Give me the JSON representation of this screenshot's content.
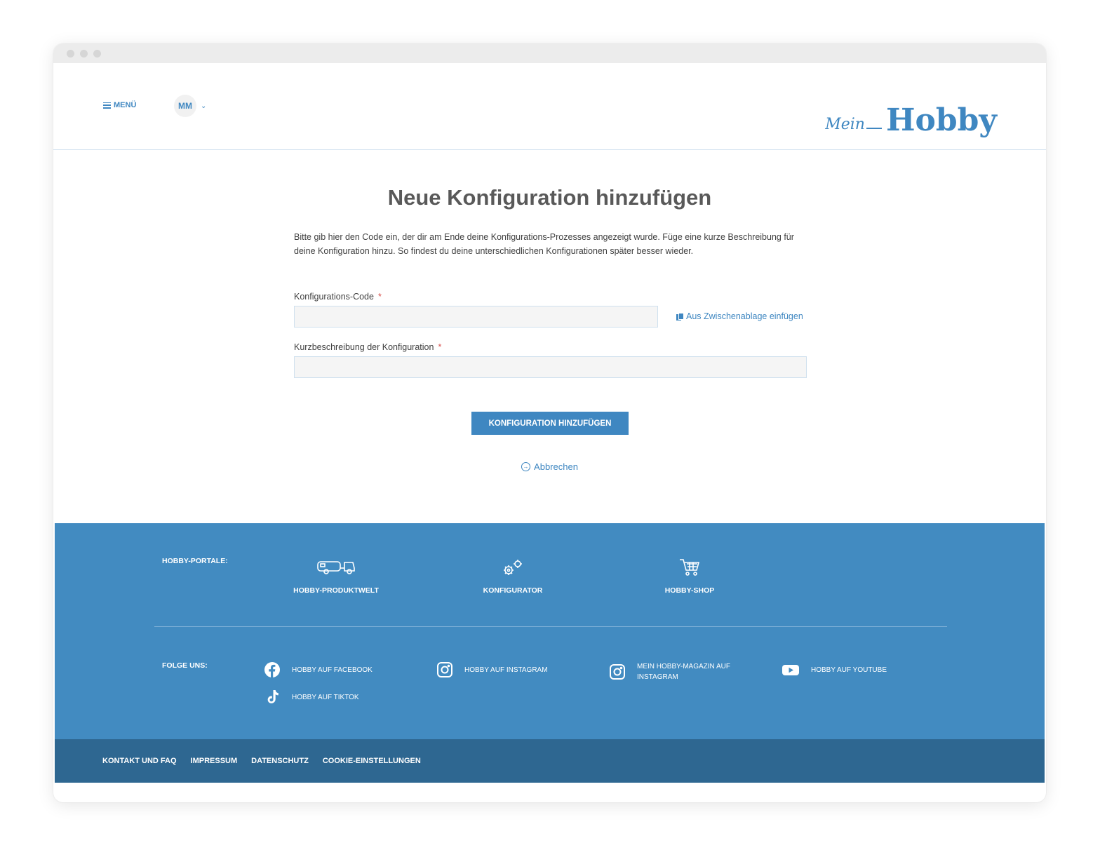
{
  "header": {
    "menu_label": "MENÜ",
    "user_initials": "MM",
    "logo_script": "Mein",
    "logo_text": "Hobby"
  },
  "main": {
    "title": "Neue Konfiguration hinzufügen",
    "intro": "Bitte gib hier den Code ein, der dir am Ende deine Konfigurations-Prozesses angezeigt wurde. Füge eine kurze Beschreibung für deine Konfiguration hinzu. So findest du deine unterschiedlichen Konfigurationen später besser wieder.",
    "code_label": "Konfigurations-Code",
    "code_value": "",
    "paste_label": "Aus Zwischenablage einfügen",
    "desc_label": "Kurzbeschreibung der Konfiguration",
    "desc_value": "",
    "required_mark": "*",
    "submit_label": "KONFIGURATION HINZUFÜGEN",
    "cancel_label": "Abbrechen"
  },
  "footer": {
    "portals_label": "HOBBY-PORTALE:",
    "portals": [
      {
        "label": "HOBBY-PRODUKTWELT",
        "icon": "caravan-icon"
      },
      {
        "label": "KONFIGURATOR",
        "icon": "gears-icon"
      },
      {
        "label": "HOBBY-SHOP",
        "icon": "cart-icon"
      }
    ],
    "follow_label": "FOLGE UNS:",
    "socials": [
      {
        "label": "HOBBY AUF FACEBOOK",
        "icon": "facebook-icon"
      },
      {
        "label": "HOBBY AUF INSTAGRAM",
        "icon": "instagram-icon"
      },
      {
        "label": "MEIN HOBBY-MAGAZIN AUF INSTAGRAM",
        "icon": "instagram-icon"
      },
      {
        "label": "HOBBY AUF YOUTUBE",
        "icon": "youtube-icon"
      },
      {
        "label": "HOBBY AUF TIKTOK",
        "icon": "tiktok-icon"
      }
    ],
    "links": [
      "KONTAKT UND FAQ",
      "IMPRESSUM",
      "DATENSCHUTZ",
      "COOKIE-EINSTELLUNGEN"
    ]
  },
  "colors": {
    "accent": "#3f87c1",
    "footer_bg": "#428bc1",
    "subfooter_bg": "#2e6791",
    "required": "#d9534f"
  }
}
